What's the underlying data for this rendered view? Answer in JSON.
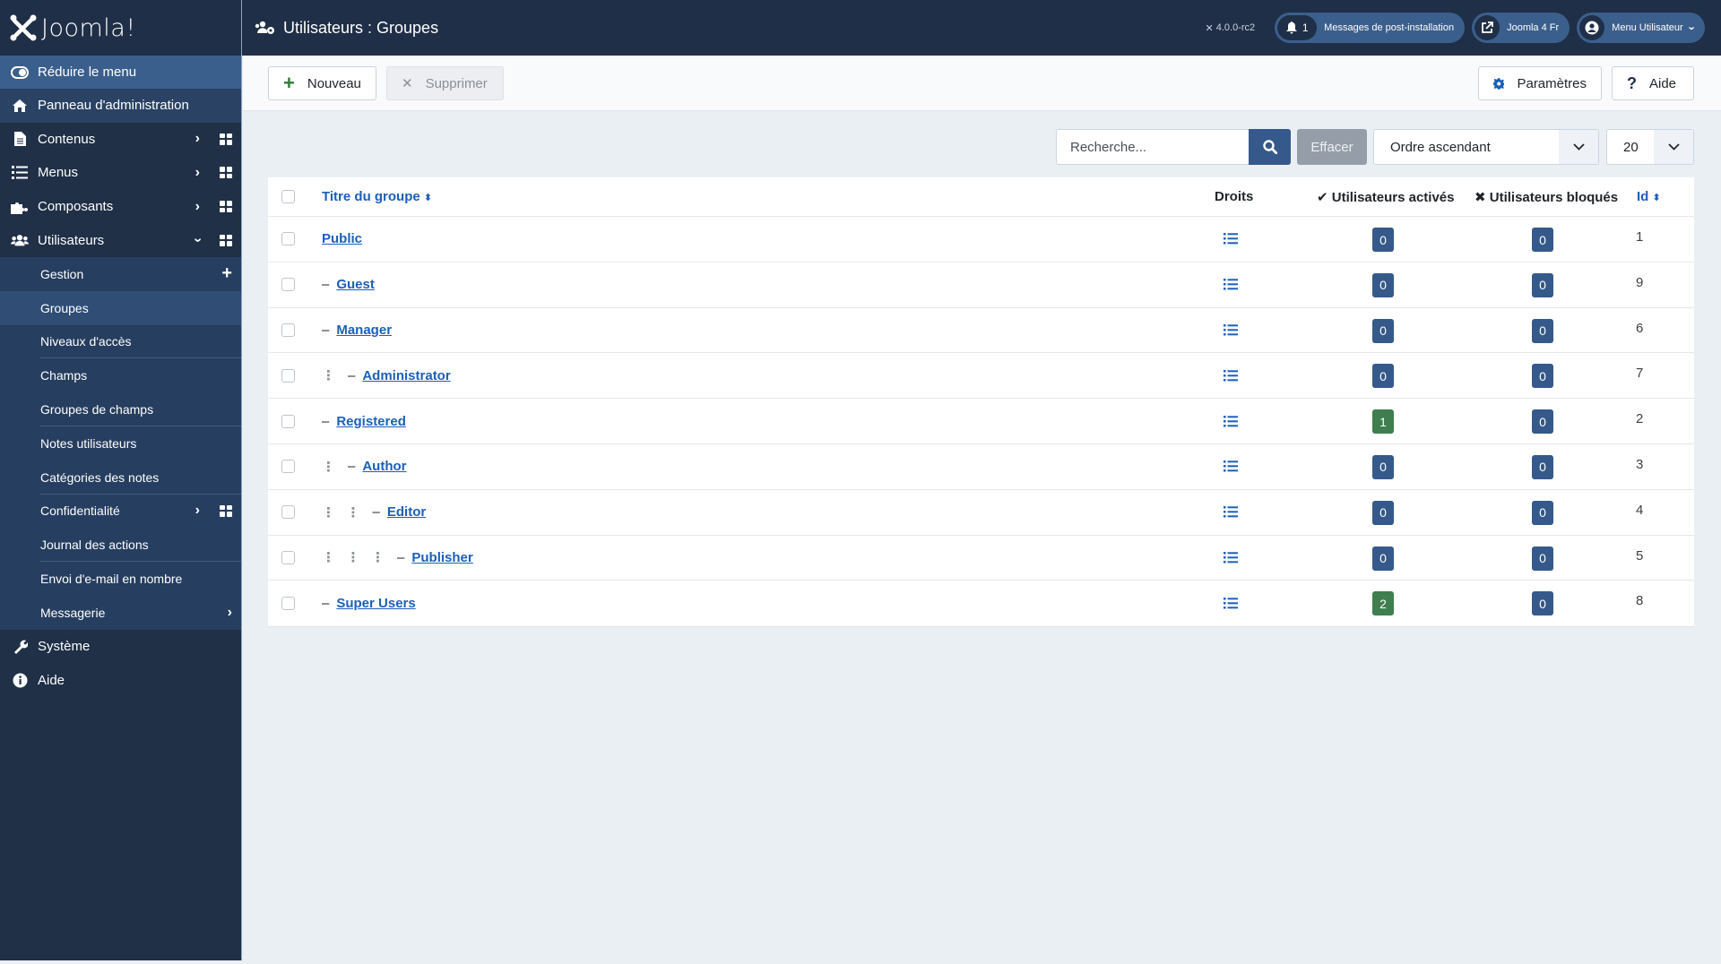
{
  "app": {
    "logo_text": "Joomla!",
    "version": "4.0.0-rc2"
  },
  "header": {
    "title": "Utilisateurs : Groupes",
    "notifications_count": "1",
    "post_install_label": "Messages de post-installation",
    "site_link_label": "Joomla 4 Fr",
    "user_menu_label": "Menu Utilisateur"
  },
  "sidebar": {
    "toggle_label": "Réduire le menu",
    "dashboard_label": "Panneau d'administration",
    "items": [
      {
        "label": "Contenus",
        "icon": "file-icon"
      },
      {
        "label": "Menus",
        "icon": "list-icon"
      },
      {
        "label": "Composants",
        "icon": "puzzle-icon"
      },
      {
        "label": "Utilisateurs",
        "icon": "users-icon"
      }
    ],
    "users_submenu": [
      {
        "label": "Gestion"
      },
      {
        "label": "Groupes"
      },
      {
        "label": "Niveaux d'accès"
      },
      {
        "label": "Champs"
      },
      {
        "label": "Groupes de champs"
      },
      {
        "label": "Notes utilisateurs"
      },
      {
        "label": "Catégories des notes"
      },
      {
        "label": "Confidentialité"
      },
      {
        "label": "Journal des actions"
      },
      {
        "label": "Envoi d'e-mail en nombre"
      },
      {
        "label": "Messagerie"
      }
    ],
    "bottom_items": [
      {
        "label": "Système",
        "icon": "wrench-icon"
      },
      {
        "label": "Aide",
        "icon": "info-icon"
      }
    ]
  },
  "toolbar": {
    "new_label": "Nouveau",
    "delete_label": "Supprimer",
    "options_label": "Paramètres",
    "help_label": "Aide"
  },
  "filters": {
    "search_placeholder": "Recherche...",
    "search_value": "",
    "clear_label": "Effacer",
    "order_selected": "Ordre ascendant",
    "limit_selected": "20"
  },
  "table": {
    "columns": {
      "title": "Titre du groupe",
      "rights": "Droits",
      "enabled": "Utilisateurs activés",
      "blocked": "Utilisateurs bloqués",
      "id": "Id"
    },
    "rows": [
      {
        "title": "Public",
        "level": 0,
        "enabled": "0",
        "blocked": "0",
        "id": "1"
      },
      {
        "title": "Guest",
        "level": 1,
        "enabled": "0",
        "blocked": "0",
        "id": "9"
      },
      {
        "title": "Manager",
        "level": 1,
        "enabled": "0",
        "blocked": "0",
        "id": "6"
      },
      {
        "title": "Administrator",
        "level": 2,
        "enabled": "0",
        "blocked": "0",
        "id": "7"
      },
      {
        "title": "Registered",
        "level": 1,
        "enabled": "1",
        "blocked": "0",
        "id": "2"
      },
      {
        "title": "Author",
        "level": 2,
        "enabled": "0",
        "blocked": "0",
        "id": "3"
      },
      {
        "title": "Editor",
        "level": 3,
        "enabled": "0",
        "blocked": "0",
        "id": "4"
      },
      {
        "title": "Publisher",
        "level": 4,
        "enabled": "0",
        "blocked": "0",
        "id": "5"
      },
      {
        "title": "Super Users",
        "level": 1,
        "enabled": "2",
        "blocked": "0",
        "id": "8"
      }
    ]
  },
  "colors": {
    "sidebar_bg": "#1f3047",
    "accent": "#35598a",
    "link": "#1c5fb8",
    "badge_blue": "#35598a",
    "badge_green": "#3f7e4f"
  }
}
